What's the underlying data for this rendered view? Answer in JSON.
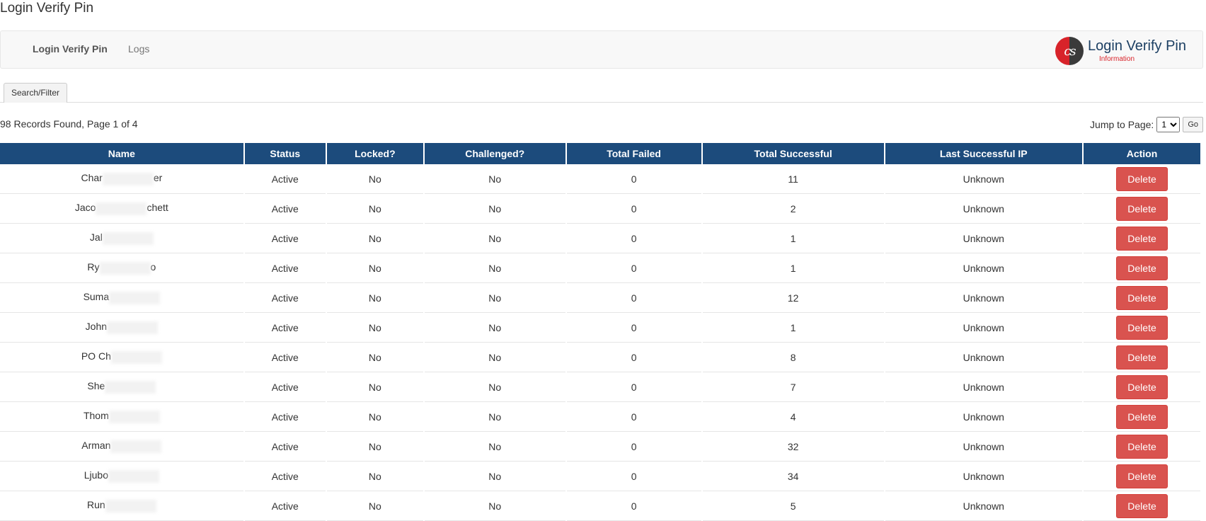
{
  "page": {
    "title": "Login Verify Pin"
  },
  "nav": {
    "items": [
      {
        "label": "Login Verify Pin",
        "active": true
      },
      {
        "label": "Logs",
        "active": false
      }
    ],
    "brand": {
      "title": "Login Verify Pin",
      "subtitle": "Information",
      "logo_text": "cs"
    }
  },
  "tabs": [
    {
      "label": "Search/Filter"
    }
  ],
  "summary": "98 Records Found, Page 1 of 4",
  "jump": {
    "label": "Jump to Page:",
    "selected": "1",
    "go_label": "Go"
  },
  "table": {
    "headers": [
      "Name",
      "Status",
      "Locked?",
      "Challenged?",
      "Total Failed",
      "Total Successful",
      "Last Successful IP",
      "Action"
    ],
    "rows": [
      {
        "name_start": "Char",
        "name_end": "er",
        "status": "Active",
        "locked": "No",
        "challenged": "No",
        "failed": "0",
        "successful": "11",
        "ip": "Unknown",
        "action": "Delete"
      },
      {
        "name_start": "Jaco",
        "name_end": "chett",
        "status": "Active",
        "locked": "No",
        "challenged": "No",
        "failed": "0",
        "successful": "2",
        "ip": "Unknown",
        "action": "Delete"
      },
      {
        "name_start": "Jal",
        "name_end": "",
        "status": "Active",
        "locked": "No",
        "challenged": "No",
        "failed": "0",
        "successful": "1",
        "ip": "Unknown",
        "action": "Delete"
      },
      {
        "name_start": "Ry",
        "name_end": "o",
        "status": "Active",
        "locked": "No",
        "challenged": "No",
        "failed": "0",
        "successful": "1",
        "ip": "Unknown",
        "action": "Delete"
      },
      {
        "name_start": "Suma",
        "name_end": "",
        "status": "Active",
        "locked": "No",
        "challenged": "No",
        "failed": "0",
        "successful": "12",
        "ip": "Unknown",
        "action": "Delete"
      },
      {
        "name_start": "John",
        "name_end": "",
        "status": "Active",
        "locked": "No",
        "challenged": "No",
        "failed": "0",
        "successful": "1",
        "ip": "Unknown",
        "action": "Delete"
      },
      {
        "name_start": "PO Ch",
        "name_end": "",
        "status": "Active",
        "locked": "No",
        "challenged": "No",
        "failed": "0",
        "successful": "8",
        "ip": "Unknown",
        "action": "Delete"
      },
      {
        "name_start": "She",
        "name_end": "",
        "status": "Active",
        "locked": "No",
        "challenged": "No",
        "failed": "0",
        "successful": "7",
        "ip": "Unknown",
        "action": "Delete"
      },
      {
        "name_start": "Thom",
        "name_end": "",
        "status": "Active",
        "locked": "No",
        "challenged": "No",
        "failed": "0",
        "successful": "4",
        "ip": "Unknown",
        "action": "Delete"
      },
      {
        "name_start": "Arman",
        "name_end": "",
        "status": "Active",
        "locked": "No",
        "challenged": "No",
        "failed": "0",
        "successful": "32",
        "ip": "Unknown",
        "action": "Delete"
      },
      {
        "name_start": "Ljubo",
        "name_end": "",
        "status": "Active",
        "locked": "No",
        "challenged": "No",
        "failed": "0",
        "successful": "34",
        "ip": "Unknown",
        "action": "Delete"
      },
      {
        "name_start": "Run",
        "name_end": "",
        "status": "Active",
        "locked": "No",
        "challenged": "No",
        "failed": "0",
        "successful": "5",
        "ip": "Unknown",
        "action": "Delete"
      }
    ]
  },
  "colors": {
    "header_bg": "#1c4b7c",
    "delete_bg": "#d9534f",
    "brand_red": "#d8232a",
    "brand_blue": "#1c3f63"
  }
}
